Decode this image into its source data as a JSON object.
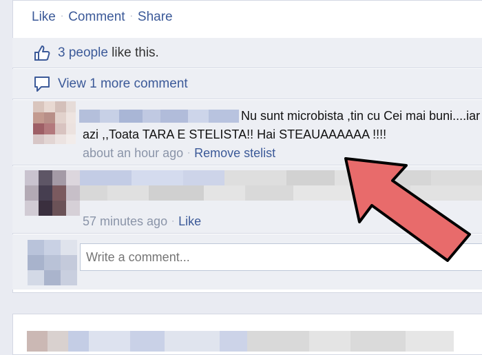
{
  "post": {
    "actions": {
      "like": "Like",
      "comment": "Comment",
      "share": "Share",
      "separator": "·"
    },
    "likes": {
      "count_link": "3 people",
      "suffix": " like this."
    },
    "view_more": "View 1 more comment"
  },
  "comments": [
    {
      "text": "Nu sunt microbista ,tin cu Cei mai buni....iar azi ,,Toata TARA E STELISTA!! Hai STEAUAAAAAA !!!!",
      "time": "about an hour ago",
      "action": "Remove stelist"
    },
    {
      "time": "57 minutes ago",
      "action": "Like"
    }
  ],
  "composer": {
    "placeholder": "Write a comment..."
  },
  "colors": {
    "link": "#3b5998",
    "feed_bg": "#edeff4",
    "arrow_fill": "#e86b6b",
    "arrow_stroke": "#000000"
  },
  "icons": {
    "like": "thumbs-up-icon",
    "comments": "speech-bubble-icon",
    "annotation": "red-arrow"
  }
}
